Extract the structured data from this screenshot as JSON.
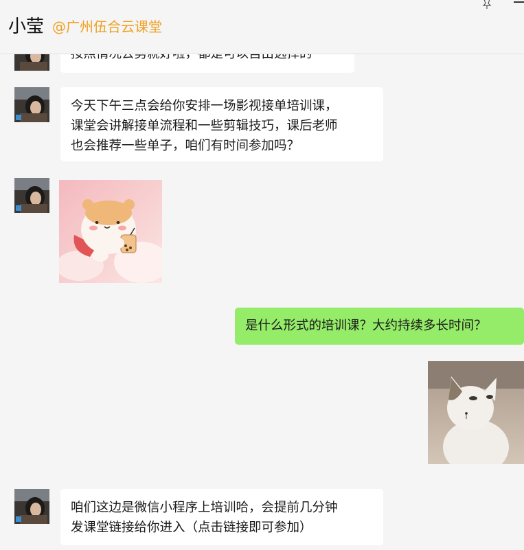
{
  "header": {
    "contact_name": "小莹",
    "contact_org": "@广州伍合云课堂",
    "pin_icon": "pin-icon",
    "minimize_icon": "minimize-icon"
  },
  "messages": [
    {
      "sender": "contact",
      "type": "text",
      "lines": [
        "按照情况去剪就好啦，都是可以自由选择的"
      ]
    },
    {
      "sender": "contact",
      "type": "text",
      "lines": [
        "今天下午三点会给你安排一场影视接单培训课，",
        "课堂会讲解接单流程和一些剪辑技巧，课后老师",
        "也会推荐一些单子，咱们有时间参加吗？"
      ]
    },
    {
      "sender": "contact",
      "type": "sticker",
      "sticker": "hamster-bubble-tea-sticker"
    },
    {
      "sender": "self",
      "type": "text",
      "lines": [
        "是什么形式的培训课？大约持续多长时间？"
      ]
    },
    {
      "sender": "self",
      "type": "sticker",
      "sticker": "pop-cat-sticker"
    },
    {
      "sender": "contact",
      "type": "text",
      "lines": [
        "咱们这边是微信小程序上培训哈，会提前几分钟",
        "发课堂链接给你进入（点击链接即可参加）"
      ]
    }
  ],
  "colors": {
    "background": "#f5f5f5",
    "incoming_bubble": "#ffffff",
    "outgoing_bubble": "#95ec69",
    "org_label": "#f0a020"
  }
}
